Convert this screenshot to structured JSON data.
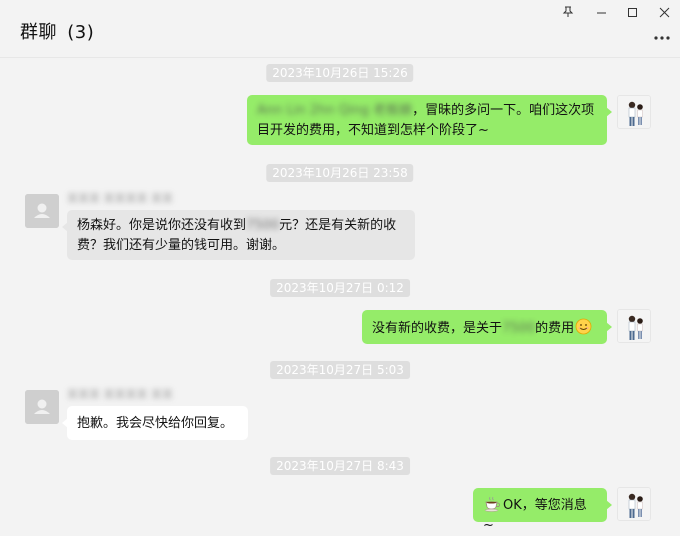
{
  "window": {
    "title": "群聊",
    "member_count": "(3)"
  },
  "messages": [
    {
      "timestamp": "2023年10月26日 15:26",
      "direction": "outgoing",
      "blurred_prefix": "Ann Lin 2hn Qing 老板娘",
      "text": "，冒昧的多问一下。咱们这次项目开发的费用，不知道到怎样个阶段了~"
    },
    {
      "timestamp": "2023年10月26日 23:58",
      "direction": "incoming",
      "sender": "某某某 某某某某 某某",
      "text_before": "杨森好。你是说你还没有收到",
      "blurred": "7500",
      "text_after": "元？还是有关新的收费？我们还有少量的钱可用。谢谢。"
    },
    {
      "timestamp": "2023年10月27日 0:12",
      "direction": "outgoing",
      "text_before": "没有新的收费，是关于",
      "blurred": "7500",
      "text_after": "的费用",
      "emoji": "smile-emoji"
    },
    {
      "timestamp": "2023年10月27日 5:03",
      "direction": "incoming",
      "sender": "某某某 某某某某 某某",
      "text": "抱歉。我会尽快给你回复。"
    },
    {
      "timestamp": "2023年10月27日 8:43",
      "direction": "outgoing",
      "emoji": "coffee-emoji",
      "text": "OK，等您消息~"
    }
  ],
  "icons": {
    "pin": "pin-icon",
    "minimize": "minimize-icon",
    "maximize": "maximize-icon",
    "close": "close-icon",
    "more": "more-icon"
  },
  "colors": {
    "outgoing_bubble": "#95ec69",
    "incoming_bubble_grey": "#e6e6e6",
    "incoming_bubble_white": "#ffffff",
    "timestamp_bg": "#dedede",
    "background": "#f3f3f3"
  }
}
